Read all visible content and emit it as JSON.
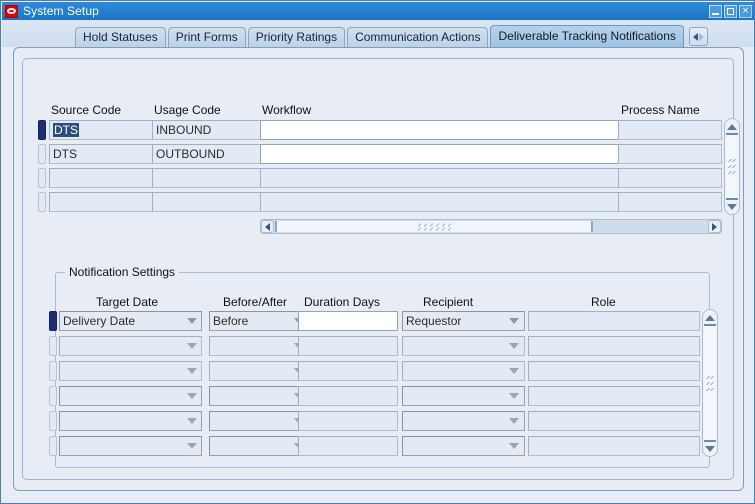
{
  "window": {
    "title": "System Setup",
    "logo_icon": "oracle-logo-icon",
    "minimize_label": "minimize-icon",
    "maximize_label": "maximize-icon",
    "close_label": "×"
  },
  "tabs": {
    "items": [
      {
        "label": "Hold Statuses",
        "active": false
      },
      {
        "label": "Print Forms",
        "active": false
      },
      {
        "label": "Priority Ratings",
        "active": false
      },
      {
        "label": "Communication Actions",
        "active": false
      },
      {
        "label": "Deliverable Tracking Notifications",
        "active": true
      }
    ],
    "scroll_left_icon": "triangle-left-icon",
    "scroll_right_icon": "triangle-right-icon"
  },
  "main_grid": {
    "headers": {
      "source_code": "Source Code",
      "usage_code": "Usage Code",
      "workflow": "Workflow",
      "process_name": "Process Name"
    },
    "rows": [
      {
        "source_code": "DTS",
        "usage_code": "INBOUND",
        "workflow": "",
        "process_name": "",
        "selected": true,
        "source_code_highlighted": true
      },
      {
        "source_code": "DTS",
        "usage_code": "OUTBOUND",
        "workflow": "",
        "process_name": "",
        "selected": false,
        "source_code_highlighted": false
      },
      {
        "source_code": "",
        "usage_code": "",
        "workflow": "",
        "process_name": "",
        "selected": false,
        "source_code_highlighted": false
      },
      {
        "source_code": "",
        "usage_code": "",
        "workflow": "",
        "process_name": "",
        "selected": false,
        "source_code_highlighted": false
      }
    ]
  },
  "notification_settings": {
    "group_title": "Notification Settings",
    "headers": {
      "target_date": "Target Date",
      "before_after": "Before/After",
      "duration_days": "Duration Days",
      "recipient": "Recipient",
      "role": "Role"
    },
    "rows": [
      {
        "target_date": "Delivery Date",
        "before_after": "Before",
        "duration_days": "",
        "recipient": "Requestor",
        "role": "",
        "selected": true
      },
      {
        "target_date": "",
        "before_after": "",
        "duration_days": "",
        "recipient": "",
        "role": "",
        "selected": false
      },
      {
        "target_date": "",
        "before_after": "",
        "duration_days": "",
        "recipient": "",
        "role": "",
        "selected": false
      },
      {
        "target_date": "",
        "before_after": "",
        "duration_days": "",
        "recipient": "",
        "role": "",
        "selected": false
      },
      {
        "target_date": "",
        "before_after": "",
        "duration_days": "",
        "recipient": "",
        "role": "",
        "selected": false
      },
      {
        "target_date": "",
        "before_after": "",
        "duration_days": "",
        "recipient": "",
        "role": "",
        "selected": false
      }
    ]
  },
  "colors": {
    "titlebar": "#1f7fd0",
    "panel_bg": "#e8edf5",
    "tab_active": "#a8c8e4",
    "row_selector_active": "#1d2f73",
    "text_selection": "#2d4d82",
    "field_bg": "#e4eaf3",
    "field_editable": "#ffffff"
  }
}
